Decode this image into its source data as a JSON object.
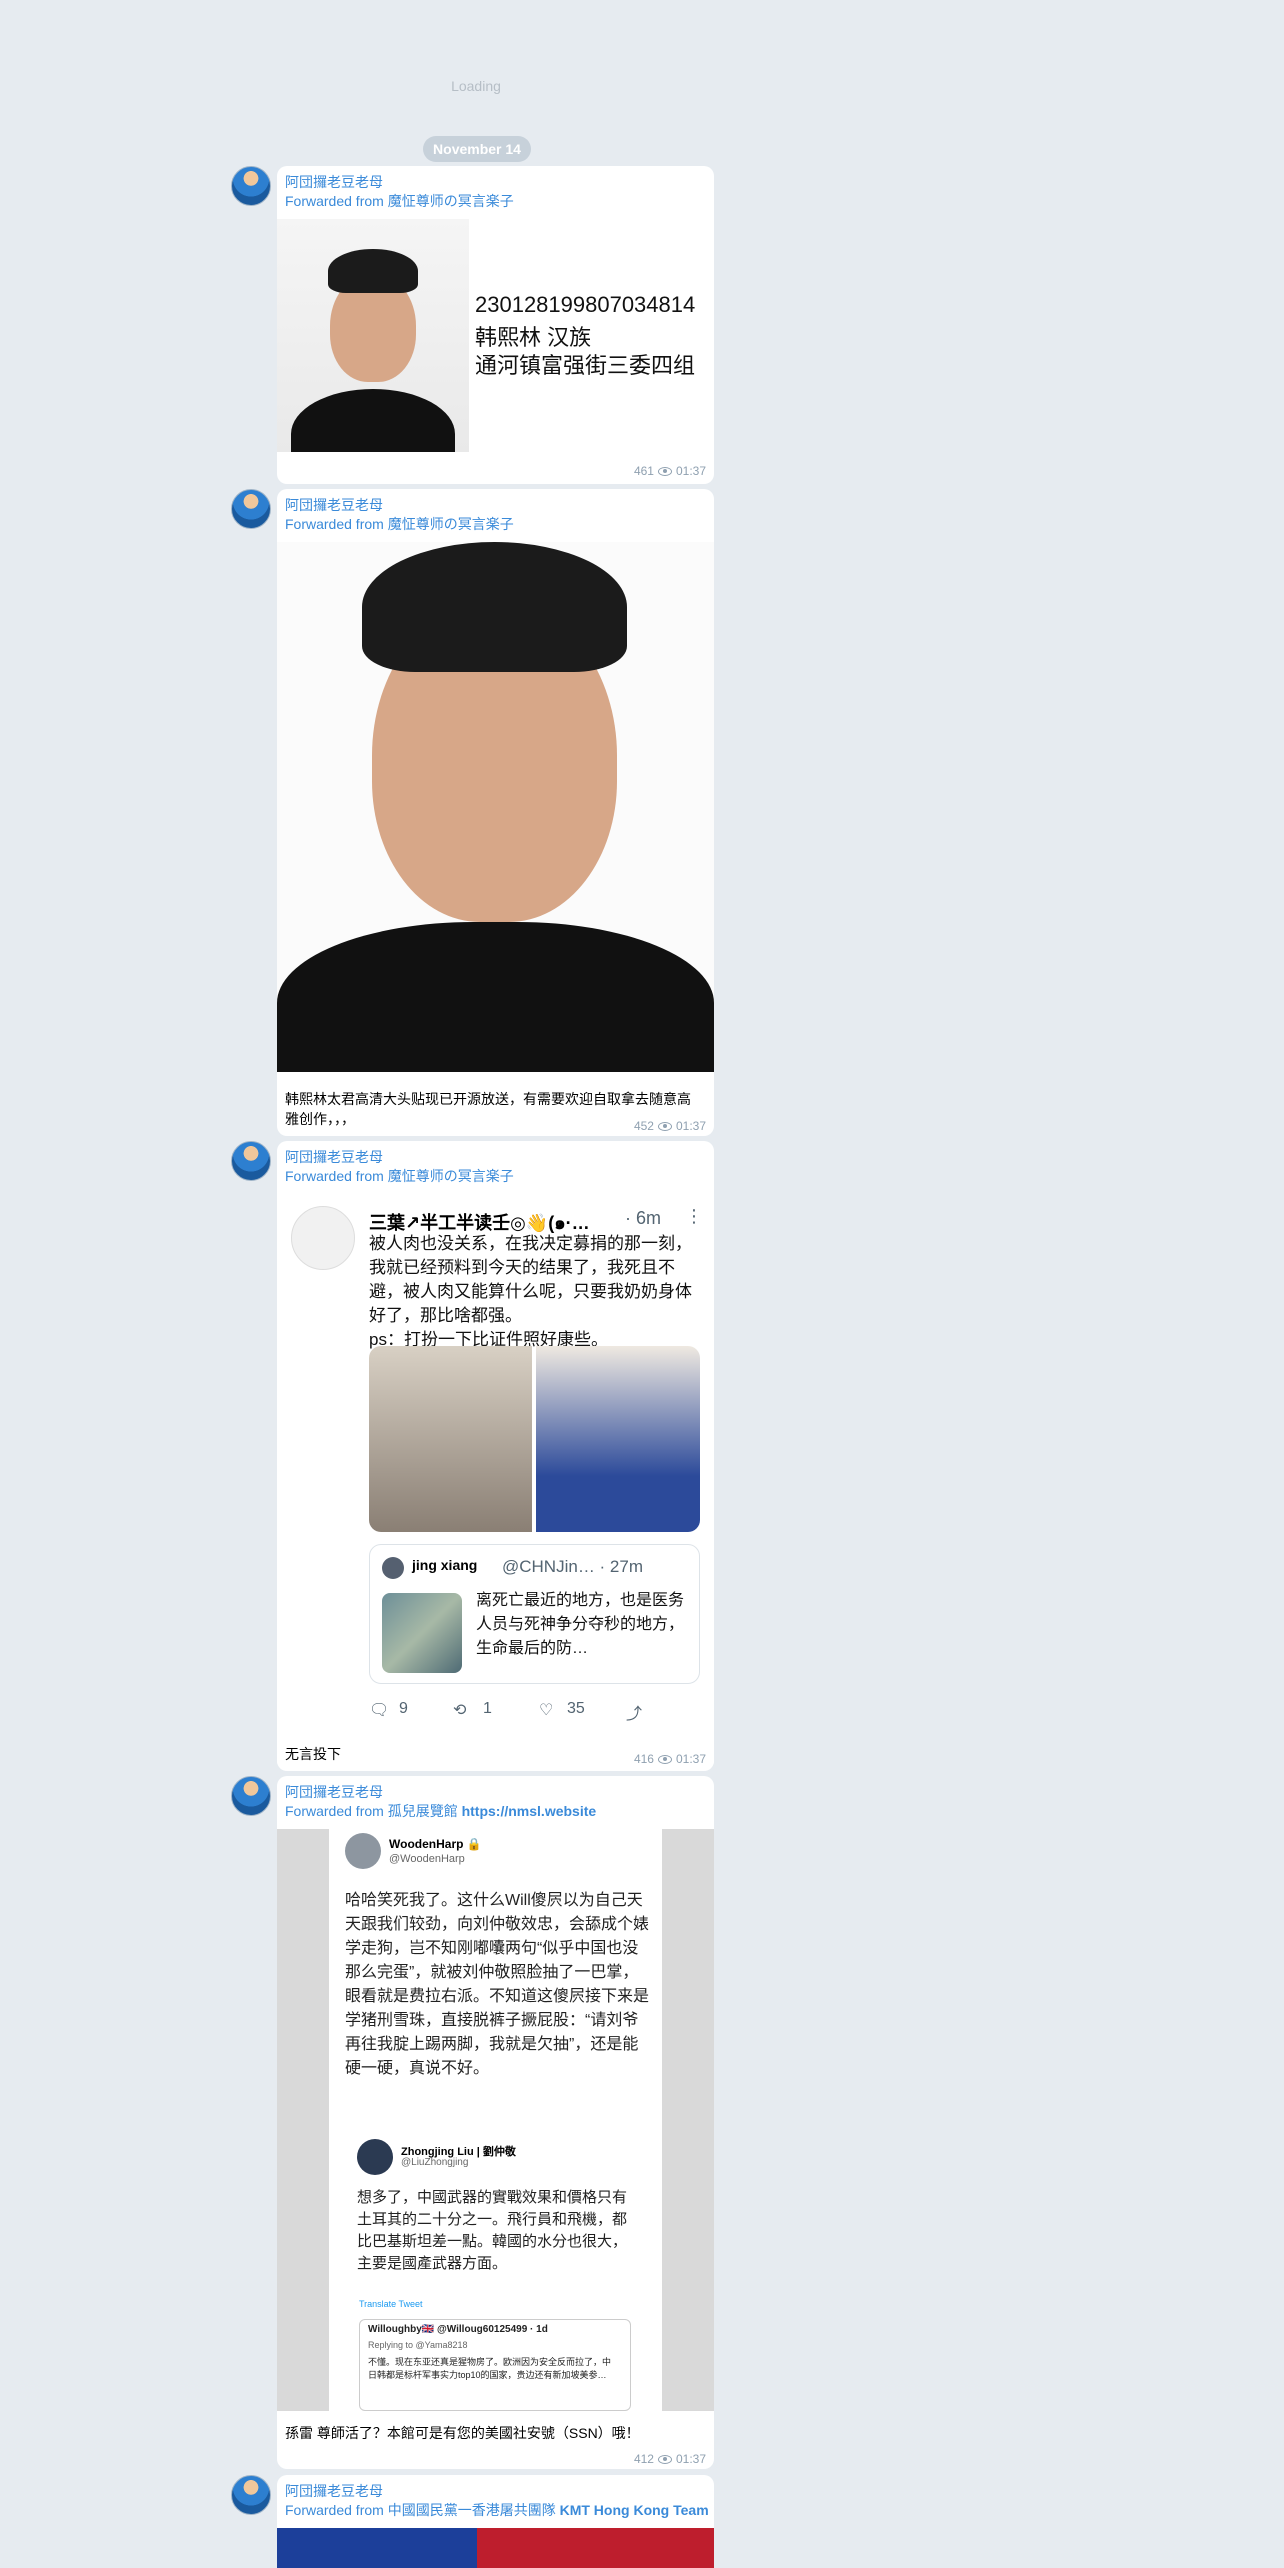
{
  "loading_text": "Loading",
  "date_separator": "November 14",
  "messages": [
    {
      "sender": "阿団攞老豆老母",
      "forwarded_prefix": "Forwarded from ",
      "forwarded_source": "魔怔尊师の冥言楽子",
      "photo_lines": [
        "230128199807034814",
        "韩熙林 汉族",
        "通河镇富强街三委四组"
      ],
      "views": "461",
      "time": "01:37"
    },
    {
      "sender": "阿団攞老豆老母",
      "forwarded_prefix": "Forwarded from ",
      "forwarded_source": "魔怔尊师の冥言楽子",
      "caption": "韩熙林太君高清大头贴现已开源放送，有需要欢迎自取拿去随意高雅创作，，，",
      "views": "452",
      "time": "01:37"
    },
    {
      "sender": "阿団攞老豆老母",
      "forwarded_prefix": "Forwarded from ",
      "forwarded_source": "魔怔尊师の冥言楽子",
      "tweet": {
        "name": "三葉↗半工半读壬◎👋(๑·…",
        "time": "· 6m",
        "more": "⋮",
        "text": "被人肉也没关系，在我决定募捐的那一刻，我就已经预料到今天的结果了，我死且不避，被人肉又能算什么呢，只要我奶奶身体好了，那比啥都强。",
        "ps": "ps：打扮一下比证件照好康些。",
        "quote": {
          "name": "jing xiang",
          "handle": "@CHNJin… · 27m",
          "text": "离死亡最近的地方，也是医务人员与死神争分夺秒的地方，生命最后的防…"
        },
        "replies": "9",
        "retweets": "1",
        "likes": "35"
      },
      "caption": "无言投下",
      "views": "416",
      "time": "01:37"
    },
    {
      "sender": "阿団攞老豆老母",
      "forwarded_prefix": "Forwarded from ",
      "forwarded_source": "孤兒展覽館",
      "forwarded_link": "https://nmsl.website",
      "screenshot": {
        "name1": "WoodenHarp 🔒",
        "handle1": "@WoodenHarp",
        "text1": "哈哈笑死我了。这什么Will傻屄以为自己天天跟我们较劲，向刘仲敬效忠，会舔成个婊学走狗，岂不知刚嘟囔两句“似乎中国也没那么完蛋”，就被刘仲敬照脸抽了一巴掌，眼看就是费拉右派。不知道这傻屄接下来是学猪刑雪珠，直接脱裤子撅屁股：“请刘爷再往我腚上踢两脚，我就是欠抽”，还是能硬一硬，真说不好。",
        "name2": "Zhongjing Liu | 劉仲敬",
        "handle2": "@LiuZhongjing",
        "text2": "想多了，中國武器的實戰效果和價格只有土耳其的二十分之一。飛行員和飛機，都比巴基斯坦差一點。韓國的水分也很大，主要是國產武器方面。",
        "translate": "Translate Tweet",
        "sub_name": "Willoughby🇬🇧 @Willoug60125499 · 1d",
        "sub_reply": "Replying to @Yama8218",
        "sub_text": "不懂。现在东亚还真是猩物房了。欧洲因为安全反而拉了，中日韩都是标杆军事实力top10的国家，贵边还有新加坡美参…"
      },
      "caption": "孫雷 尊師活了？本館可是有您的美國社安號（SSN）哦！",
      "views": "412",
      "time": "01:37"
    },
    {
      "sender": "阿団攞老豆老母",
      "forwarded_prefix": "Forwarded from ",
      "forwarded_source": "中國國民黨一香港屠共團隊",
      "forwarded_link": "KMT Hong Kong Team"
    }
  ]
}
